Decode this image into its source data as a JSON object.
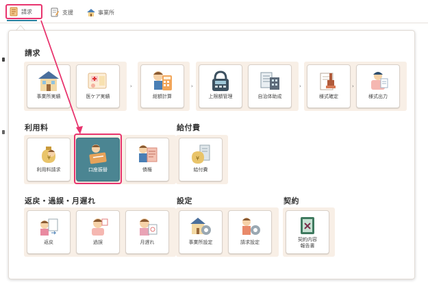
{
  "tabs": [
    {
      "label": "請求",
      "icon": "invoice-icon",
      "active": true
    },
    {
      "label": "支援",
      "icon": "support-memo-icon",
      "active": false
    },
    {
      "label": "事業所",
      "icon": "office-house-icon",
      "active": false
    }
  ],
  "sections": {
    "seikyu": {
      "title": "請求",
      "items": [
        {
          "label": "事業所実績",
          "icon": "office-building-icon"
        },
        {
          "label": "医ケア実績",
          "icon": "medical-care-icon"
        },
        {
          "label": "総額計算",
          "icon": "calculator-icon"
        },
        {
          "label": "上限額管理",
          "icon": "cash-register-icon"
        },
        {
          "label": "自治体助成",
          "icon": "municipal-subsidy-icon"
        },
        {
          "label": "様式確定",
          "icon": "form-stamp-icon"
        },
        {
          "label": "様式出力",
          "icon": "form-output-icon"
        }
      ]
    },
    "riyoryo": {
      "title": "利用料",
      "items": [
        {
          "label": "利用料請求",
          "icon": "money-bag-icon"
        },
        {
          "label": "口座振替",
          "icon": "bank-transfer-icon",
          "selected": true
        },
        {
          "label": "債権",
          "icon": "receivable-icon"
        }
      ]
    },
    "kyufuhi": {
      "title": "給付費",
      "items": [
        {
          "label": "給付費",
          "icon": "benefit-money-icon"
        }
      ]
    },
    "henrei": {
      "title": "返戻・過誤・月遅れ",
      "items": [
        {
          "label": "返戻",
          "icon": "return-icon"
        },
        {
          "label": "過誤",
          "icon": "error-correction-icon"
        },
        {
          "label": "月遅れ",
          "icon": "late-month-icon"
        }
      ]
    },
    "settei": {
      "title": "設定",
      "items": [
        {
          "label": "事業所設定",
          "icon": "office-settings-icon"
        },
        {
          "label": "請求設定",
          "icon": "billing-settings-icon"
        }
      ]
    },
    "keiyaku": {
      "title": "契約",
      "items": [
        {
          "label": "契約内容\n報告書",
          "icon": "contract-report-icon"
        }
      ]
    }
  },
  "colors": {
    "accent_pink": "#e8336d",
    "selected_teal": "#4b8592",
    "group_bg": "#f8efe6",
    "tab_underline": "#2a7f9f"
  }
}
